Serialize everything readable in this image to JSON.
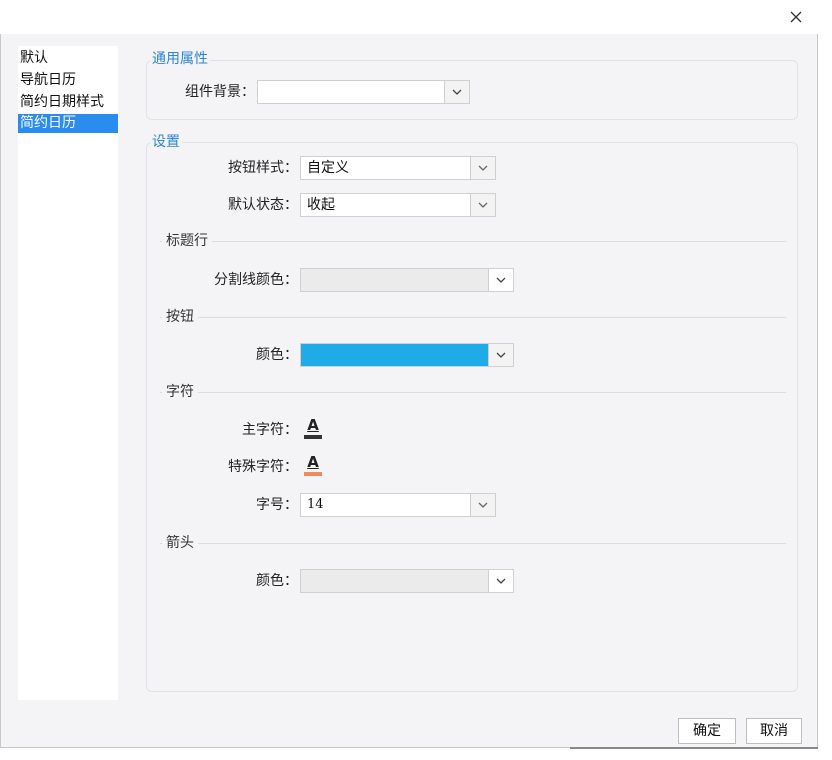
{
  "sidebar": {
    "items": [
      {
        "label": "默认",
        "selected": false
      },
      {
        "label": "导航日历",
        "selected": false
      },
      {
        "label": "简约日期样式",
        "selected": false
      },
      {
        "label": "简约日历",
        "selected": true
      }
    ]
  },
  "general": {
    "title": "通用属性",
    "background_label": "组件背景：",
    "background_value": ""
  },
  "settings": {
    "title": "设置",
    "button_style_label": "按钮样式：",
    "button_style_value": "自定义",
    "default_state_label": "默认状态：",
    "default_state_value": "收起",
    "title_row": {
      "title": "标题行",
      "divider_color_label": "分割线颜色："
    },
    "button": {
      "title": "按钮",
      "color_label": "颜色：",
      "color_value": "#1fabe5"
    },
    "chars": {
      "title": "字符",
      "main_label": "主字符：",
      "main_icon": "font-color-icon",
      "main_color": "#333333",
      "special_label": "特殊字符：",
      "special_icon": "font-color-icon",
      "special_color": "#f08a5d",
      "size_label": "字号：",
      "size_value": "14"
    },
    "arrow": {
      "title": "箭头",
      "color_label": "颜色："
    }
  },
  "footer": {
    "ok_label": "确定",
    "cancel_label": "取消"
  },
  "colors": {
    "accent": "#2e86d8",
    "selected_bg": "#2b8cf0"
  }
}
